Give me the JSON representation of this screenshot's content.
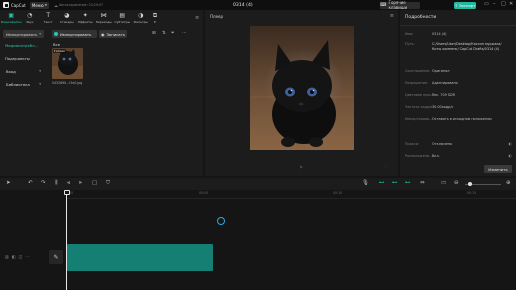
{
  "app": {
    "logo_text": "CapCut",
    "menu_label": "Меню",
    "autosave_text": "Автосохранение: 20:29:07",
    "document_title": "0314 (4)",
    "hotkeys_label": "Горячие клавиши",
    "export_label": "Экспорт"
  },
  "tool_tabs": [
    {
      "label": "Медиафайлы",
      "icon": "media-icon",
      "glyph": "▣",
      "active": true
    },
    {
      "label": "Звук",
      "icon": "audio-icon",
      "glyph": "◔",
      "active": false
    },
    {
      "label": "Текст",
      "icon": "text-icon",
      "glyph": "T",
      "active": false
    },
    {
      "label": "Стикеры",
      "icon": "sticker-icon",
      "glyph": "◕",
      "active": false
    },
    {
      "label": "Эффекты",
      "icon": "effects-icon",
      "glyph": "✦",
      "active": false
    },
    {
      "label": "Переходы",
      "icon": "transitions-icon",
      "glyph": "⋈",
      "active": false
    },
    {
      "label": "Субтитры",
      "icon": "captions-icon",
      "glyph": "▤",
      "active": false
    },
    {
      "label": "Фильтры",
      "icon": "filters-icon",
      "glyph": "◑",
      "active": false
    },
    {
      "label": "Е",
      "icon": "adjust-icon",
      "glyph": "⧉",
      "active": false
    }
  ],
  "sidebar": {
    "items": [
      {
        "label": "Импортировать",
        "type": "dropdown",
        "highlight": true
      },
      {
        "label": "Медиапотребл...",
        "type": "item",
        "active": true
      },
      {
        "label": "Подпроекты",
        "type": "item",
        "active": false
      },
      {
        "label": "Вход",
        "type": "dropdown",
        "highlight": false
      },
      {
        "label": "Библиотека",
        "type": "dropdown",
        "highlight": false
      }
    ]
  },
  "media": {
    "import_label": "Импортировать",
    "record_label": "Записать",
    "all_label": "Все",
    "thumb_badge": "Готово",
    "thumb_name": "5432890...f1e0.jpg"
  },
  "player": {
    "title": "Плеер"
  },
  "details": {
    "title": "Подробности",
    "rows": [
      {
        "key": "Имя:",
        "value": "0314 (4)"
      },
      {
        "key": "Путь:",
        "value": "C:/Users/User/Desktop/Кассин мурызка/Коты компенк/ CapCut Drafts/0314 (4)"
      },
      {
        "key": "Соотношение ...",
        "value": "Оригинал"
      },
      {
        "key": "Разрешение:",
        "value": "Адаптировано"
      },
      {
        "key": "Цветовое прос...",
        "value": "Rec. 709 SDR"
      },
      {
        "key": "Частота кадров:",
        "value": "30.00кадр/с"
      },
      {
        "key": "Импортирова...",
        "value": "Оставить в исходном положении"
      },
      {
        "key": "Прокси:",
        "value": "Отключено"
      },
      {
        "key": "Расположени...",
        "value": "Вкл."
      }
    ],
    "change_label": "Изменить"
  },
  "timeline": {
    "ruler": [
      "00:00",
      "00:05",
      "00:10",
      "00:15",
      "00:20"
    ]
  },
  "colors": {
    "accent": "#1fcbb0",
    "export_bg": "#1fb9a0",
    "clip": "#167f73",
    "panel": "#1c1c1c",
    "background": "#151515"
  }
}
